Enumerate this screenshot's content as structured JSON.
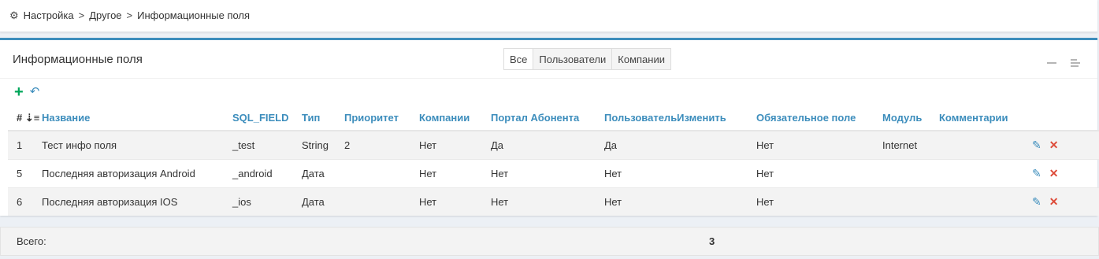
{
  "breadcrumb": {
    "items": [
      "Настройка",
      "Другое",
      "Информационные поля"
    ],
    "separator": ">"
  },
  "panel": {
    "title": "Информационные поля",
    "filters": [
      "Все",
      "Пользователи",
      "Компании"
    ],
    "active_filter": "Все"
  },
  "table": {
    "columns": [
      "#",
      "Название",
      "SQL_FIELD",
      "Тип",
      "Приоритет",
      "Компании",
      "Портал Абонента",
      "ПользовательИзменить",
      "Обязательное поле",
      "Модуль",
      "Комментарии"
    ],
    "rows": [
      [
        "1",
        "Тест инфо поля",
        "_test",
        "String",
        "2",
        "Нет",
        "Да",
        "Да",
        "Нет",
        "Internet",
        ""
      ],
      [
        "5",
        "Последняя авторизация Android",
        "_android",
        "Дата",
        "",
        "Нет",
        "Нет",
        "Нет",
        "Нет",
        "",
        ""
      ],
      [
        "6",
        "Последняя авторизация IOS",
        "_ios",
        "Дата",
        "",
        "Нет",
        "Нет",
        "Нет",
        "Нет",
        "",
        ""
      ]
    ]
  },
  "footer": {
    "total_label": "Всего:",
    "total_value": "3"
  },
  "colors": {
    "accent": "#3c8dbc",
    "add": "#00a65a",
    "delete": "#dd4b39"
  }
}
